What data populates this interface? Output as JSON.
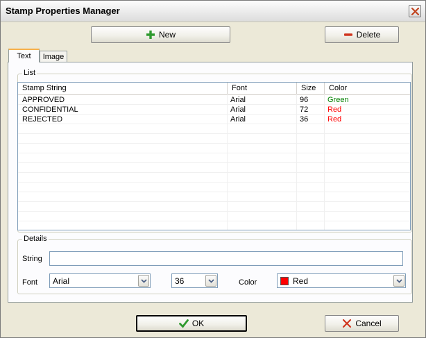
{
  "window": {
    "title": "Stamp Properties Manager"
  },
  "toolbar": {
    "new_label": "New",
    "delete_label": "Delete"
  },
  "tabs": [
    {
      "label": "Text"
    },
    {
      "label": "Image"
    }
  ],
  "list": {
    "group_label": "List",
    "columns": [
      "Stamp String",
      "Font",
      "Size",
      "Color"
    ],
    "rows": [
      {
        "string": "APPROVED",
        "font": "Arial",
        "size": "96",
        "color": "Green",
        "color_hex": "#008000"
      },
      {
        "string": "CONFIDENTIAL",
        "font": "Arial",
        "size": "72",
        "color": "Red",
        "color_hex": "#ff0000"
      },
      {
        "string": "REJECTED",
        "font": "Arial",
        "size": "36",
        "color": "Red",
        "color_hex": "#ff0000"
      }
    ]
  },
  "details": {
    "group_label": "Details",
    "string_label": "String",
    "string_value": "",
    "font_label": "Font",
    "font_value": "Arial",
    "size_value": "36",
    "color_label": "Color",
    "color_value": "Red",
    "color_swatch": "#ff0000"
  },
  "footer": {
    "ok_label": "OK",
    "cancel_label": "Cancel"
  },
  "icons": {
    "new": "plus-icon",
    "delete": "minus-icon",
    "ok": "checkmark-icon",
    "cancel": "x-icon",
    "close": "close-icon"
  }
}
